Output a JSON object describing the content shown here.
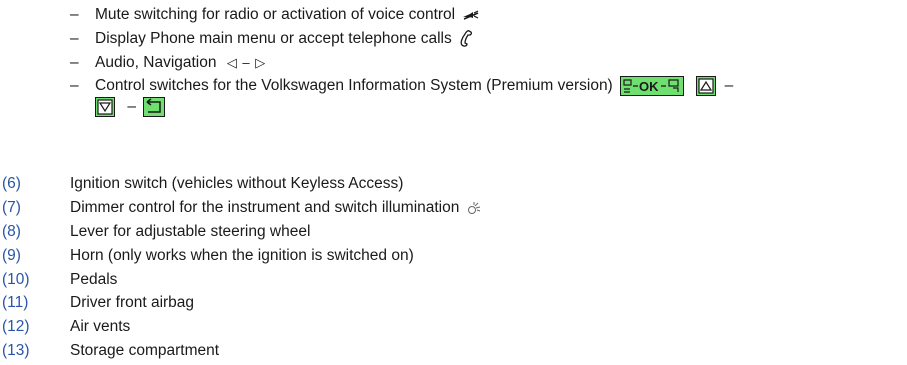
{
  "sub_items": [
    {
      "dash": "–",
      "text": "Mute switching for radio or activation of voice control",
      "icon": "mute-speaker-icon"
    },
    {
      "dash": "–",
      "text": "Display Phone main menu or accept telephone calls",
      "icon": "phone-handset-icon"
    },
    {
      "dash": "–",
      "text": "Audio, Navigation",
      "icon": "left-right-arrows-icon",
      "arrows": "◁ – ▷"
    },
    {
      "dash": "–",
      "text": "Control switches for the Volkswagen Information System (Premium version)",
      "ok_label": "OK",
      "sep1": "–",
      "sep2": "–",
      "icons": [
        "menu-back-ok-forward-icon",
        "up-arrow-box-icon",
        "down-arrow-box-icon",
        "return-arrow-icon"
      ]
    }
  ],
  "numbered_items": [
    {
      "num": "(6)",
      "text": "Ignition switch (vehicles without Keyless Access)"
    },
    {
      "num": "(7)",
      "text": "Dimmer control for the instrument and switch illumination",
      "icon": "illumination-dimmer-icon"
    },
    {
      "num": "(8)",
      "text": "Lever for adjustable steering wheel"
    },
    {
      "num": "(9)",
      "text": "Horn (only works when the ignition is switched on)"
    },
    {
      "num": "(10)",
      "text": "Pedals"
    },
    {
      "num": "(11)",
      "text": "Driver front airbag"
    },
    {
      "num": "(12)",
      "text": "Air vents"
    },
    {
      "num": "(13)",
      "text": "Storage compartment"
    }
  ],
  "colors": {
    "number": "#2a55a8",
    "text": "#1a1a1a",
    "button_green": "#6fe06f"
  }
}
